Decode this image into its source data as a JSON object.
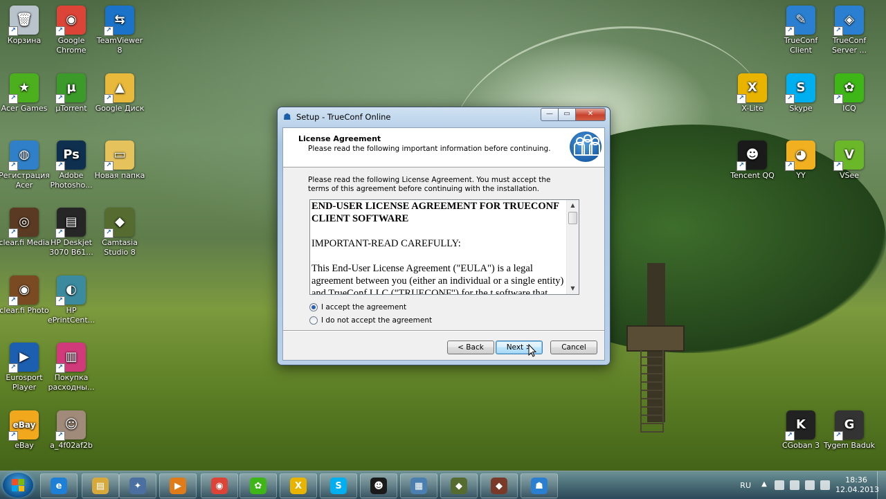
{
  "desktop_icons": [
    {
      "label": "Корзина",
      "glyph": "🗑",
      "color": "#b9c3cc",
      "icon": "recycle-bin-icon"
    },
    {
      "label": "Google Chrome",
      "glyph": "◉",
      "color": "#db4437",
      "icon": "chrome-icon"
    },
    {
      "label": "TeamViewer 8",
      "glyph": "⇆",
      "color": "#1a73c8",
      "icon": "teamviewer-icon"
    },
    {
      "label": "Acer Games",
      "glyph": "★",
      "color": "#4caf1e",
      "icon": "acer-games-icon"
    },
    {
      "label": "µTorrent",
      "glyph": "µ",
      "color": "#3b9a2a",
      "icon": "utorrent-icon"
    },
    {
      "label": "Google Диск",
      "glyph": "▲",
      "color": "#e8b93a",
      "icon": "google-drive-folder-icon"
    },
    {
      "label": "Регистрация Acer",
      "glyph": "◍",
      "color": "#2f80c9",
      "icon": "acer-registration-icon"
    },
    {
      "label": "Adobe Photosho...",
      "glyph": "Ps",
      "color": "#0f2f4e",
      "icon": "photoshop-icon"
    },
    {
      "label": "Новая папка",
      "glyph": "▭",
      "color": "#e6c25c",
      "icon": "folder-icon"
    },
    {
      "label": "clear.fi Media",
      "glyph": "◎",
      "color": "#5a3a22",
      "icon": "clearfi-media-icon"
    },
    {
      "label": "HP Deskjet 3070 B61...",
      "glyph": "▤",
      "color": "#262626",
      "icon": "printer-icon"
    },
    {
      "label": "Camtasia Studio 8",
      "glyph": "◆",
      "color": "#556b2f",
      "icon": "camtasia-icon"
    },
    {
      "label": "clear.fi Photo",
      "glyph": "◉",
      "color": "#7a4a22",
      "icon": "clearfi-photo-icon"
    },
    {
      "label": "HP ePrintCent...",
      "glyph": "◐",
      "color": "#3c8a9e",
      "icon": "hp-eprint-icon"
    },
    {
      "label": "Eurosport Player",
      "glyph": "▶",
      "color": "#1c5fb0",
      "icon": "eurosport-icon"
    },
    {
      "label": "Покупка расходны...",
      "glyph": "▥",
      "color": "#d03a7a",
      "icon": "supplies-icon"
    },
    {
      "label": "eBay",
      "glyph": "eBay",
      "color": "#f2a81d",
      "icon": "ebay-icon"
    },
    {
      "label": "a_4f02af2b",
      "glyph": "☺",
      "color": "#a08a7a",
      "icon": "photo-file-icon"
    },
    {
      "label": "TrueConf Client",
      "glyph": "✎",
      "color": "#2a7fd0",
      "icon": "trueconf-client-icon"
    },
    {
      "label": "TrueConf Server ...",
      "glyph": "◈",
      "color": "#2a7fd0",
      "icon": "trueconf-server-icon"
    },
    {
      "label": "X-Lite",
      "glyph": "X",
      "color": "#e8b400",
      "icon": "xlite-icon"
    },
    {
      "label": "Skype",
      "glyph": "S",
      "color": "#00aff0",
      "icon": "skype-icon"
    },
    {
      "label": "ICQ",
      "glyph": "✿",
      "color": "#3fb618",
      "icon": "icq-icon"
    },
    {
      "label": "Tencent QQ",
      "glyph": "☻",
      "color": "#1a1a1a",
      "icon": "qq-icon"
    },
    {
      "label": "YY",
      "glyph": "◕",
      "color": "#f0b020",
      "icon": "yy-icon"
    },
    {
      "label": "VSee",
      "glyph": "V",
      "color": "#6ab82a",
      "icon": "vsee-icon"
    },
    {
      "label": "CGoban 3",
      "glyph": "K",
      "color": "#222222",
      "icon": "cgoban-icon"
    },
    {
      "label": "Tygem Baduk",
      "glyph": "G",
      "color": "#333333",
      "icon": "tygem-icon"
    }
  ],
  "dialog": {
    "title": "Setup - TrueConf Online",
    "heading": "License Agreement",
    "subheading": "Please read the following important information before continuing.",
    "intro": "Please read the following License Agreement. You must accept the terms of this agreement before continuing with the installation.",
    "license_paragraphs": [
      "END-USER LICENSE AGREEMENT FOR TRUECONF CLIENT SOFTWARE",
      "IMPORTANT-READ CAREFULLY:",
      "This End-User License Agreement (\"EULA\") is a legal agreement between you (either an individual or a single entity) and TrueConf LLC (\"TRUECONF\") for the t software that accompanies this"
    ],
    "accept_label": "I accept the agreement",
    "decline_label": "I do not accept the agreement",
    "accept_selected": true,
    "back_label": "< Back",
    "next_label": "Next >",
    "cancel_label": "Cancel",
    "minimize_glyph": "—",
    "maximize_glyph": "▭",
    "close_glyph": "✕"
  },
  "taskbar": {
    "pinned": [
      {
        "icon": "internet-explorer-icon",
        "glyph": "e",
        "color": "#1e7fd6"
      },
      {
        "icon": "file-explorer-icon",
        "glyph": "▤",
        "color": "#d6a93a"
      },
      {
        "icon": "setup-wizard-icon",
        "glyph": "✦",
        "color": "#4a6fa0"
      },
      {
        "icon": "media-player-icon",
        "glyph": "▶",
        "color": "#e07b1a"
      },
      {
        "icon": "chrome-icon",
        "glyph": "◉",
        "color": "#db4437"
      },
      {
        "icon": "icq-icon",
        "glyph": "✿",
        "color": "#3fb618"
      },
      {
        "icon": "xlite-icon",
        "glyph": "X",
        "color": "#e8b400"
      },
      {
        "icon": "skype-icon",
        "glyph": "S",
        "color": "#00aff0"
      },
      {
        "icon": "qq-icon",
        "glyph": "☻",
        "color": "#1a1a1a"
      },
      {
        "icon": "control-panel-icon",
        "glyph": "▦",
        "color": "#4a7fb0"
      },
      {
        "icon": "camtasia-icon",
        "glyph": "◆",
        "color": "#556b2f"
      },
      {
        "icon": "camtasia-recorder-icon",
        "glyph": "◆",
        "color": "#7a3a2a"
      },
      {
        "icon": "trueconf-icon",
        "glyph": "☗",
        "color": "#2a7fd0"
      }
    ],
    "language": "RU",
    "time": "18:36",
    "date": "12.04.2013"
  }
}
